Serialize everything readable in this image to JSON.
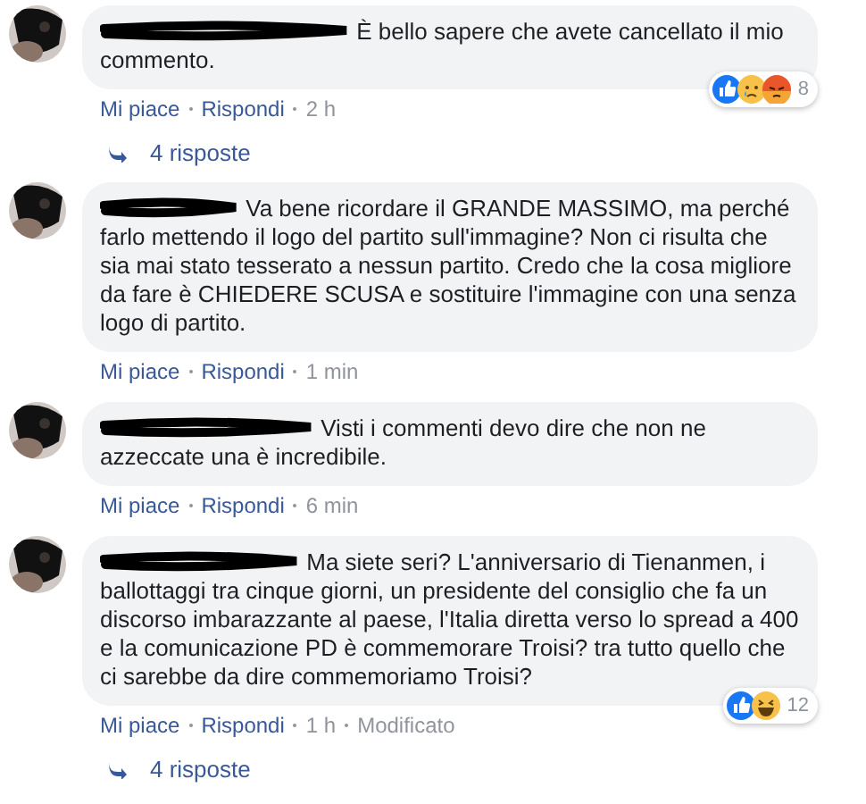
{
  "comments": [
    {
      "text": "È bello sapere che avete cancellato il mio commento.",
      "actions": [
        "Mi piace",
        "Rispondi"
      ],
      "time": "2 h",
      "reactions": {
        "icons": [
          {
            "kind": "like"
          },
          {
            "kind": "sad"
          },
          {
            "kind": "angry"
          }
        ],
        "count": "8"
      },
      "replies": "4 risposte"
    },
    {
      "text": "Va bene ricordare il GRANDE MASSIMO, ma perché farlo mettendo il logo del partito sull'immagine? Non ci risulta che sia mai stato tesserato a nessun partito. Credo che la cosa migliore da fare è CHIEDERE SCUSA e sostituire l'immagine con una senza logo di partito.",
      "actions": [
        "Mi piace",
        "Rispondi"
      ],
      "time": "1 min"
    },
    {
      "text": "Visti i commenti devo dire che non ne azzeccate una è incredibile.",
      "actions": [
        "Mi piace",
        "Rispondi"
      ],
      "time": "6 min"
    },
    {
      "text": "Ma siete seri? L'anniversario di Tienanmen, i ballottaggi tra cinque giorni, un presidente del consiglio che fa un discorso imbarazzante al paese, l'Italia diretta verso lo spread a 400 e la comunicazione PD è commemorare Troisi? tra tutto quello che ci sarebbe da dire commemoriamo Troisi?",
      "actions": [
        "Mi piace",
        "Rispondi"
      ],
      "time": "1 h",
      "edited": "Modificato",
      "reactions": {
        "icons": [
          {
            "kind": "like"
          },
          {
            "kind": "haha"
          }
        ],
        "count": "12"
      },
      "replies": "4 risposte"
    }
  ]
}
